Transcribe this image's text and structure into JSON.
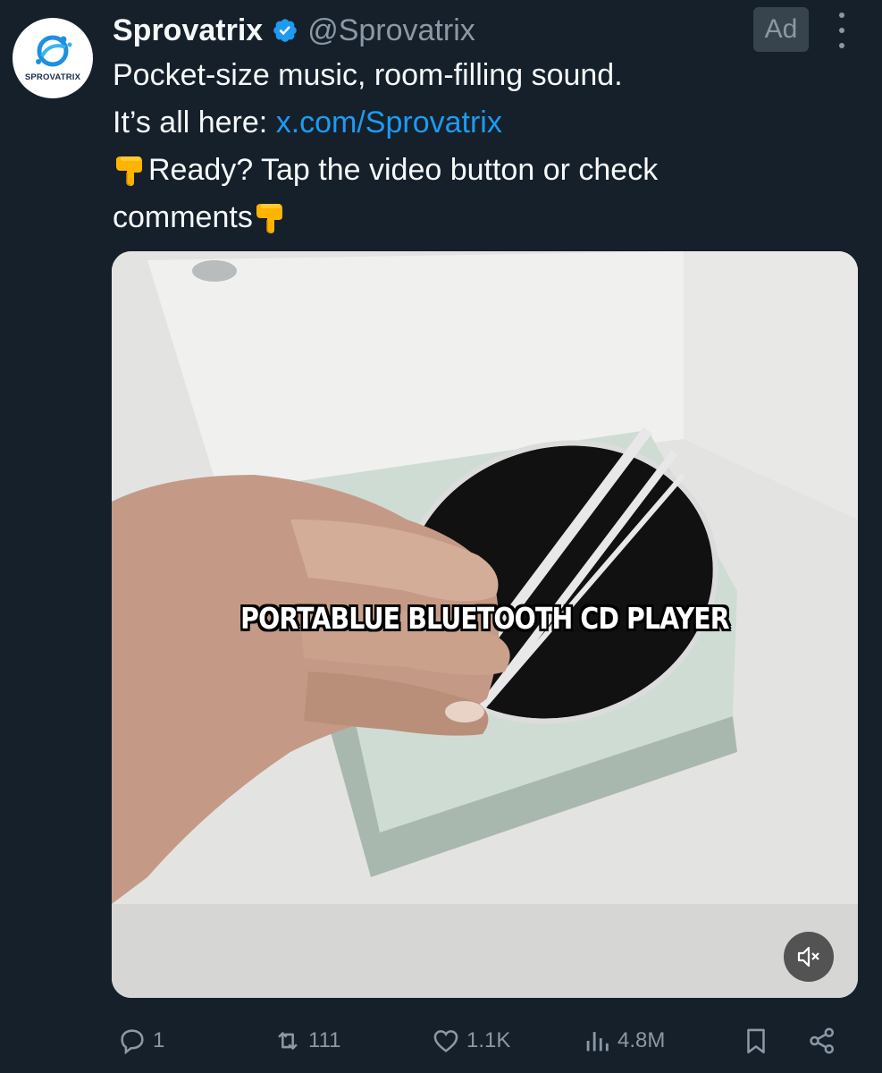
{
  "author": {
    "avatar_text": "SPROVATRIX",
    "display_name": "Sprovatrix",
    "handle": "@Sprovatrix",
    "verified_icon": "verified-badge-icon"
  },
  "ad_label": "Ad",
  "tweet": {
    "line1": "Pocket-size music, room-filling sound.",
    "line2_prefix": "It’s all here: ",
    "line2_link": "x.com/Sprovatrix",
    "line3": "Ready? Tap the video button or check",
    "line4": "comments"
  },
  "media": {
    "caption": "PORTABLUE BLUETOOTH CD PLAYER",
    "mute_icon": "muted-speaker-icon"
  },
  "actions": {
    "reply_count": "1",
    "repost_count": "111",
    "like_count": "1.1K",
    "view_count": "4.8M"
  },
  "colors": {
    "background": "#15202b",
    "text": "#f7f9f9",
    "secondary": "#8b98a5",
    "link": "#1d9bf0"
  }
}
